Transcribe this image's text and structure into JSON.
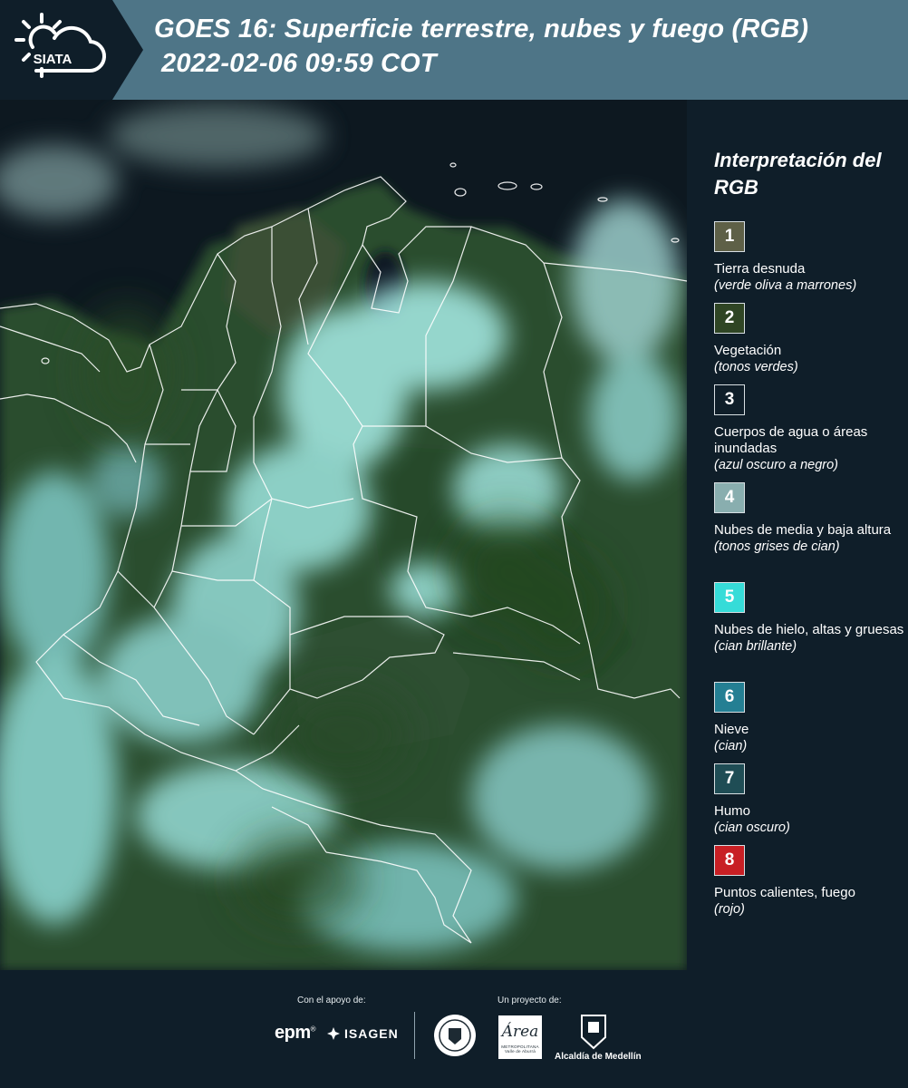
{
  "header": {
    "logo_text": "SIATA",
    "title_line1": "GOES 16: Superficie terrestre, nubes y fuego (RGB)",
    "title_line2": "2022-02-06 09:59 COT"
  },
  "map": {
    "image_name": "colombia-goes16-rgb-satellite",
    "colors": {
      "ocean": "#0d1820",
      "land": "#2a4a2e",
      "cloud": "#a8eee8",
      "borders": "#ffffff"
    }
  },
  "legend": {
    "title": "Interpretación del RGB",
    "items": [
      {
        "num": "1",
        "color": "#5e6047",
        "label": "Tierra desnuda",
        "sub": "(verde oliva a marrones)"
      },
      {
        "num": "2",
        "color": "#2f4524",
        "label": "Vegetación",
        "sub": "(tonos verdes)"
      },
      {
        "num": "3",
        "color": "#0f1e29",
        "label": "Cuerpos de agua o áreas inundadas",
        "sub": "(azul oscuro a negro)"
      },
      {
        "num": "4",
        "color": "#89aeaf",
        "label": "Nubes de media y baja altura",
        "sub": "(tonos grises de cian)"
      },
      {
        "num": "5",
        "color": "#36dcd8",
        "label": "Nubes de hielo, altas y gruesas",
        "sub": "(cian brillante)"
      },
      {
        "num": "6",
        "color": "#247f93",
        "label": "Nieve",
        "sub": "(cian)"
      },
      {
        "num": "7",
        "color": "#1f4d55",
        "label": "Humo",
        "sub": "(cian oscuro)"
      },
      {
        "num": "8",
        "color": "#c81f24",
        "label": "Puntos calientes, fuego",
        "sub": "(rojo)"
      }
    ]
  },
  "footer": {
    "support_label": "Con el apoyo de:",
    "project_label": "Un proyecto de:",
    "sponsors": [
      "epm",
      "ISAGEN"
    ],
    "area_logo_line1": "Área",
    "area_logo_line2": "METROPOLITANA Valle de Aburrá",
    "medellin_label": "Alcaldía de Medellín"
  }
}
